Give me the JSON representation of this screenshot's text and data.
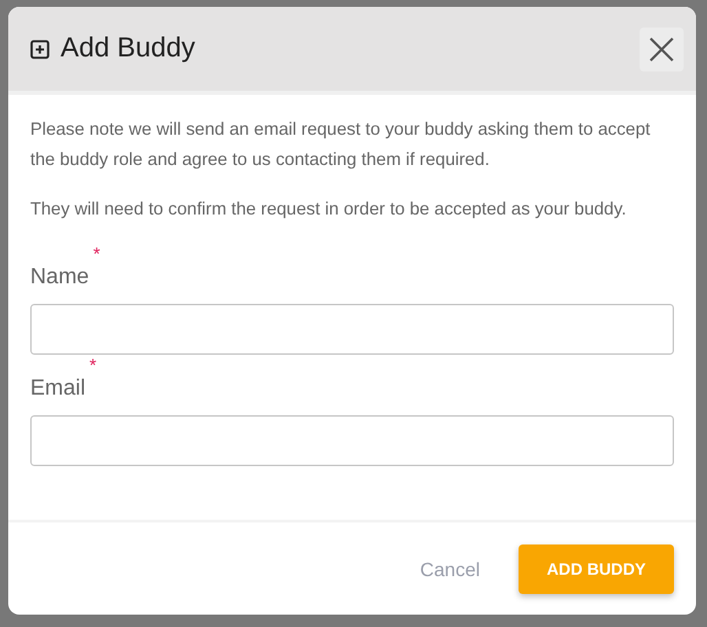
{
  "dialog": {
    "title": "Add Buddy",
    "paragraphs": [
      "Please note we will send an email request to your buddy asking them to accept the buddy role and agree to us contacting them if required.",
      "They will need to confirm the request in order to be accepted as your buddy."
    ],
    "fields": [
      {
        "label": "Name",
        "required_mark": "*"
      },
      {
        "label": "Email",
        "required_mark": "*"
      }
    ],
    "buttons": [
      {
        "label": "Cancel",
        "kind": "text"
      },
      {
        "label": "ADD BUDDY",
        "kind": "primary"
      }
    ]
  }
}
